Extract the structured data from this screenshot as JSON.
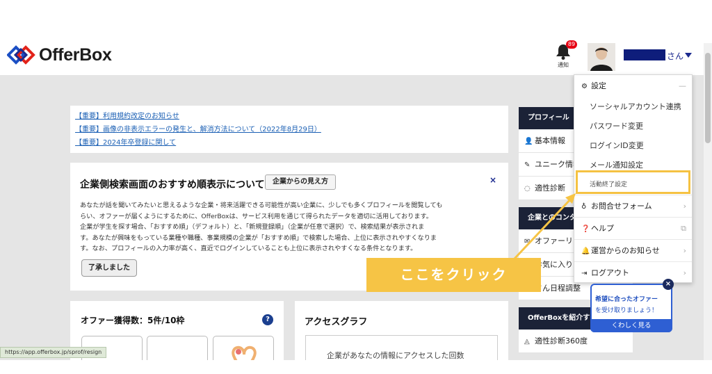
{
  "header": {
    "logo_text": "OfferBox",
    "notification_label": "通知",
    "notification_count": "89",
    "user_suffix": "さん"
  },
  "notices": [
    "【重要】利用規約改定のお知らせ",
    "【重要】画像の非表示エラーの発生と、解消方法について（2022年8月29日）",
    "【重要】2024年卒登録に関して"
  ],
  "recommendation": {
    "title": "企業側検索画面のおすすめ順表示について",
    "view_button": "企業からの見え方",
    "close": "×",
    "body_lines": [
      "あなたが話を聞いてみたいと思えるような企業・将来活躍できる可能性が高い企業に、少しでも多くプロフィールを閲覧しても",
      "らい、オファーが届くようにするために、OfferBoxは、サービス利用を通じて得られたデータを適切に活用しております。",
      "企業が学生を探す場合、「おすすめ順」（デフォルト）と、「新規登録順」（企業が任意で選択）で、検索結果が表示されま",
      "す。あなたが興味をもっている業種や職種、事業規模の企業が「おすすめ順」で検索した場合、上位に表示されやすくなりま",
      "す。なお、プロフィールの入力率が高く、直近でログインしていることも上位に表示されやすくなる条件となります。"
    ],
    "ack_button": "了承しました"
  },
  "offer_card": {
    "title": "オファー獲得数：5件/10枠",
    "help": "?"
  },
  "access_card": {
    "title": "アクセスグラフ",
    "text": "企業があなたの情報にアクセスした回数"
  },
  "sidebar": {
    "profile_head": "プロフィール",
    "profile_items": [
      {
        "icon": "person-icon",
        "glyph": "👤",
        "label": "基本情報"
      },
      {
        "icon": "puzzle-icon",
        "glyph": "✎",
        "label": "ユニーク情報"
      },
      {
        "icon": "diagnosis-icon",
        "glyph": "◌",
        "label": "適性診断"
      }
    ],
    "company_head": "企業とのコンタクト",
    "company_items": [
      {
        "icon": "mail-icon",
        "glyph": "✉",
        "label": "オファーリスト"
      },
      {
        "icon": "bookmark-icon",
        "glyph": "",
        "label": "お気に入り"
      },
      {
        "icon": "calendar-icon",
        "glyph": "",
        "label": "さん日程調整"
      }
    ],
    "intro_head": "OfferBoxを紹介する",
    "intro_items": [
      {
        "icon": "diagnosis360-icon",
        "glyph": "◬",
        "label": "適性診断360度"
      }
    ]
  },
  "menu": {
    "settings": "設定",
    "settings_collapse": "—",
    "sub_items": [
      "ソーシャルアカウント連携",
      "パスワード変更",
      "ログインID変更",
      "メール通知設定",
      "活動終了設定"
    ],
    "contact": "お問合せフォーム",
    "help": "ヘルプ",
    "news": "運営からのお知らせ",
    "logout": "ログアウト"
  },
  "annotation": {
    "callout": "ここをクリック",
    "color": "#f6c445"
  },
  "promo": {
    "line1": "希望に合ったオファー",
    "line2": "を受け取りましょう！",
    "button": "くわしく見る",
    "close": "×"
  },
  "status_url": "https://app.offerbox.jp/sprof/resign",
  "colors": {
    "brand_navy": "#1b2a8f",
    "sidebar_head": "#1b2237",
    "page_bg": "#e5e5e5",
    "link": "#1a5fb4",
    "promo_blue": "#2e5fd3",
    "badge_red": "#e60012"
  }
}
